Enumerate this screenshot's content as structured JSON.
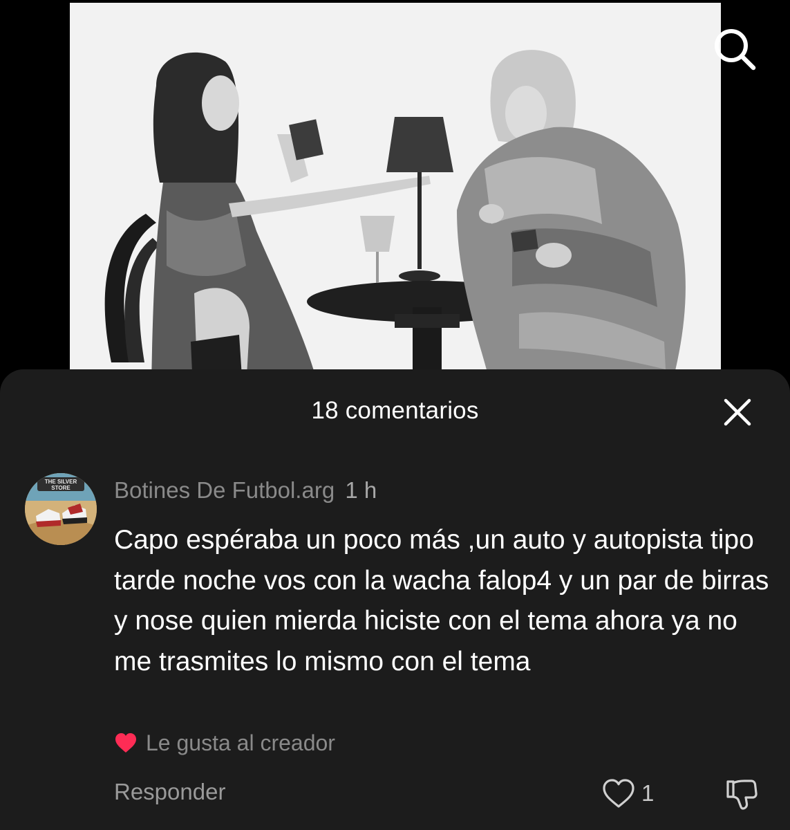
{
  "comments_sheet": {
    "title": "18 comentarios"
  },
  "comment": {
    "author": "Botines De Futbol.arg",
    "time": "1 h",
    "avatar_text": "THE SILVER STORE",
    "text": "Capo espéraba un poco más ,un auto y autopista tipo tarde noche vos con la wacha falop4 y un par de birras y nose quien mierda hiciste con el tema ahora ya no me trasmites lo mismo con el tema",
    "creator_like_label": "Le gusta al creador",
    "reply_label": "Responder",
    "like_count": "1"
  },
  "icons": {
    "search": "search-icon",
    "close": "close-icon",
    "heart": "heart-icon",
    "like": "heart-outline-icon",
    "dislike": "thumbs-down-icon"
  },
  "colors": {
    "sheet_background": "#1c1c1c",
    "creator_heart": "#fe2c55",
    "muted_text": "#8a8a8a"
  }
}
